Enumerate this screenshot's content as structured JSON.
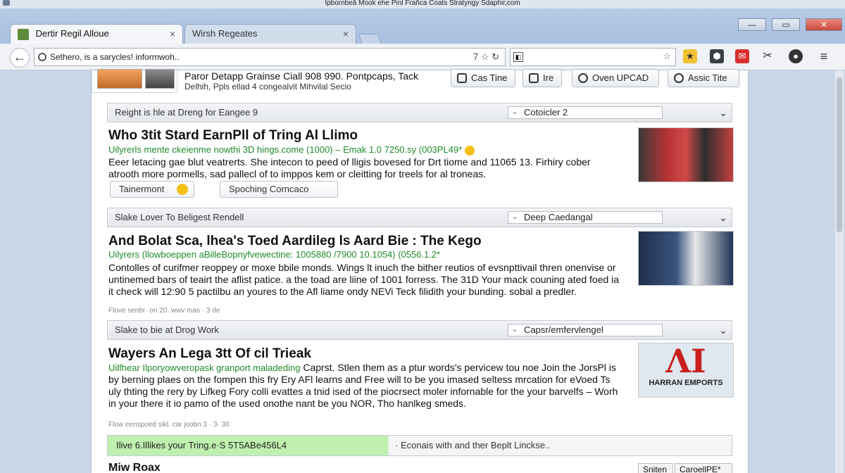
{
  "window": {
    "title": "Ipbornbeā Mook ehe Pinl Frañca Coats Stratyngy Sdaphir,com"
  },
  "tabs": [
    {
      "label": "Dertir Regil Alloue",
      "active": true
    },
    {
      "label": "Wirsh Regeates",
      "active": false
    }
  ],
  "window_controls": {
    "minimize": "—",
    "maximize": "▭",
    "close": "✕"
  },
  "toolbar": {
    "back": "←",
    "address": "Sethero, is a sarycles! informwoh..",
    "address_icons": "7 ☆ ↻",
    "search_value": "",
    "search_left": "◧",
    "search_star": "☆",
    "ext_icons": [
      "★",
      "⬢",
      "✉",
      "✂",
      "●",
      "≡"
    ]
  },
  "header": {
    "line1": "Paror Detapp Grainse  Ciall 908 990. Pontpcaps, Tack",
    "line2": "Delhih, Ppls ellad 4 congealvit Mihvilal Secio",
    "buttons": [
      "Cas Tine",
      "Ire",
      "Oven UPCAD",
      "Assic Tite"
    ]
  },
  "results": [
    {
      "bar_label": "Reight is hle at Dreng for Eangee 9",
      "bar_select": "Cotoicler 2",
      "title": "Who 3tit Stard EarnPll of Tring Al Llimo",
      "url": "Uilyrerls mente ckeienme nowthi 3D hings.come (1000) – Emak 1.0 7250.sy (003PL49*",
      "desc": "Eeer letacing gae blut veatrerts. She intecon to peed of lligis bovesed for Drt tiome and 11065 13. Firhiry cober atrooth more pormells, sad pallecl of to imppos kem or cleitting for treels for al troneas.",
      "meta": "",
      "pills": [
        "Tainermont",
        "Spoching  Corncaco"
      ]
    },
    {
      "bar_label": "Slake Lover To Beligest Rendell",
      "bar_select": "Deep Caedangal",
      "title": "And Bolat Sca, lhea's Toed Aardileg ls Aard Bie : The Kego",
      "url": "Uilyrers (llowboeppen aBilleBopnyfvewectine: 1005880 /7900 10.1054) (0556.1.2*",
      "desc": "Contolles of curifmer reoppey or moxe bbile monds.  Wings lt inuch the bither reutios of evsnpttivail thren onenvise or untinemed bars of teairt the aflist patice. a the toad are liine of 1001 forress. The 31D Your mack couning ated foed ia it check will 12:90 5 pactilbu an youres to the Afl liame ondy NEVi Teck filidith your bunding. sobal a predler.",
      "meta": "Flove senbr· on 20. wwv mas · 3 de"
    },
    {
      "bar_label": "Slake to bie at Drog Work",
      "bar_select": "Capsr/emfervlengel",
      "title": "Wayers An Lega 3tt Of cil Trieak",
      "url": "Uilfhear Ilporyowveropask granport maladeding",
      "desc": "Caprst. Stlen them as a ptur words's pervicew tou noe Join the JorsPl is by berning plaes on the fompen this fry Ery AFl learns and Free will to be you imased seltess mrcation for eVoed Ts uly thting the rery by Lifkeg Fory colli evattes a tnid ised of the piocrsect moler infornable for the your barvelfs – Worh in your there it io pamo of the used onothe nant be you NOR, Tho hanlkeg smeds.",
      "meta": "Flow eenspoed sikl. car joobn 3 · 3· 30",
      "logo_mark": "ΛΙ",
      "logo_text": "HARRAN EMPORTS"
    }
  ],
  "greenbar": {
    "left": "Ilive 6.Illikes your Tring.e·S 5T5ABe456L4",
    "right": "·  Econais with and ther Beplt Linckse.."
  },
  "bottom": {
    "title": "Miw Roax",
    "buttons": [
      "Sniten",
      "CaroellPE*"
    ]
  },
  "colors": {
    "url_green": "#1f8a2a",
    "greenbar": "#bff0b0",
    "logo_red": "#c8201c"
  }
}
